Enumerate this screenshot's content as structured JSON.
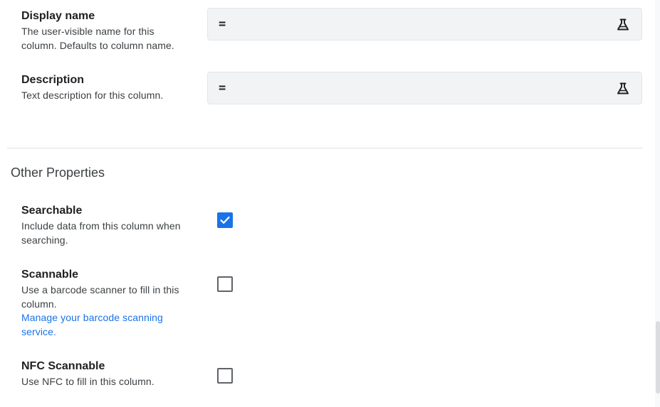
{
  "display_name": {
    "label": "Display name",
    "description": "The user-visible name for this column. Defaults to column name.",
    "value": "="
  },
  "description_field": {
    "label": "Description",
    "description": "Text description for this column.",
    "value": "="
  },
  "other_properties": {
    "title": "Other Properties",
    "searchable": {
      "label": "Searchable",
      "description": "Include data from this column when searching.",
      "checked": true
    },
    "scannable": {
      "label": "Scannable",
      "description": "Use a barcode scanner to fill in this column.",
      "link": "Manage your barcode scanning service.",
      "checked": false
    },
    "nfc_scannable": {
      "label": "NFC Scannable",
      "description": "Use NFC to fill in this column.",
      "checked": false
    }
  },
  "icons": {
    "formula_test": "flask-icon",
    "checkmark": "check-icon"
  },
  "colors": {
    "accent": "#1a73e8",
    "field_bg": "#f1f3f4"
  }
}
